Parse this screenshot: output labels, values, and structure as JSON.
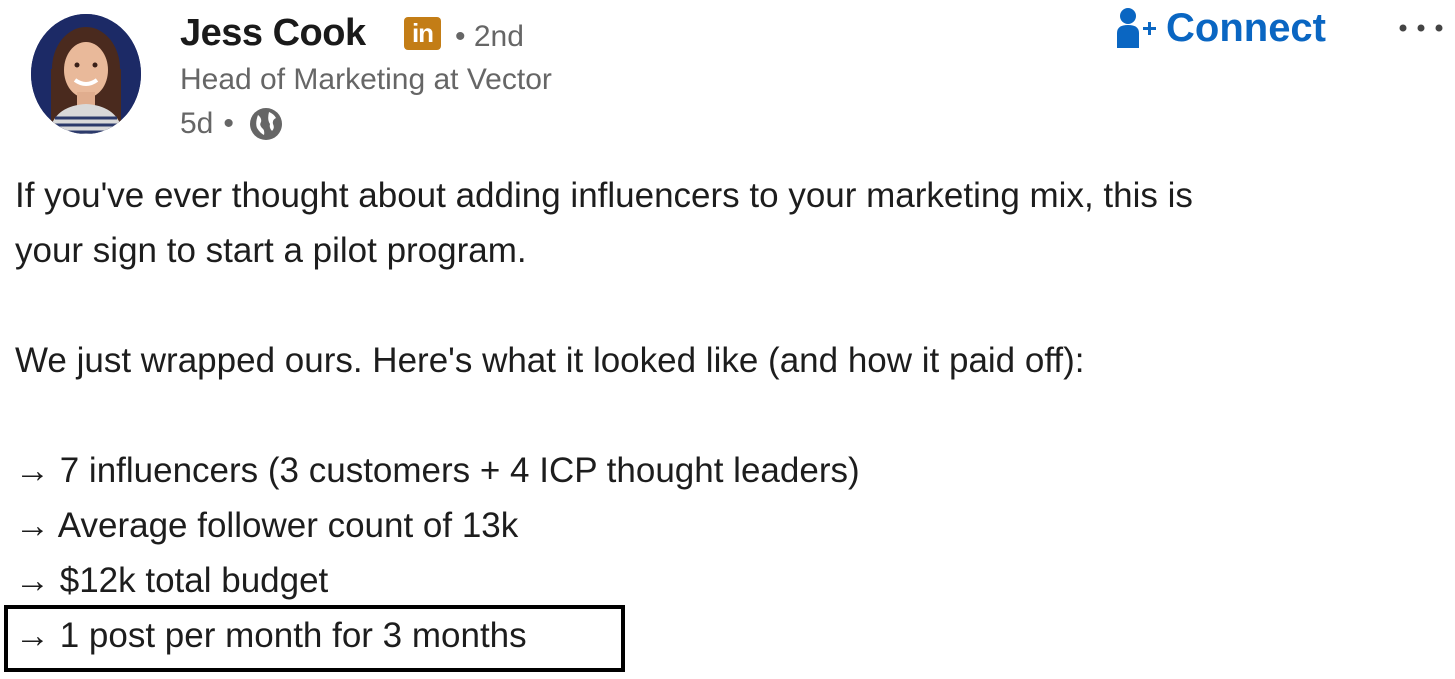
{
  "author": {
    "name": "Jess Cook",
    "badge": "in",
    "degree": "• 2nd",
    "headline": "Head of Marketing at Vector",
    "time": "5d",
    "time_separator": "•",
    "visibility_icon": "globe-icon"
  },
  "actions": {
    "connect_label": "Connect",
    "connect_icon": "add-person-icon",
    "more_label": "···"
  },
  "post": {
    "lines": [
      "If you've ever thought about adding influencers to your marketing mix, this is",
      "your sign to start a pilot program.",
      "We just wrapped ours. Here's what it looked like (and how it paid off):"
    ],
    "bullets": [
      "→ 7 influencers (3 customers + 4 ICP thought leaders)",
      "→ Average follower count of 13k",
      "→ $12k total budget",
      "→ 1 post per month for 3 months"
    ]
  },
  "colors": {
    "connect": "#0a66c2",
    "badge": "#c37d16",
    "muted": "#666666",
    "text": "#1d1d1d"
  }
}
